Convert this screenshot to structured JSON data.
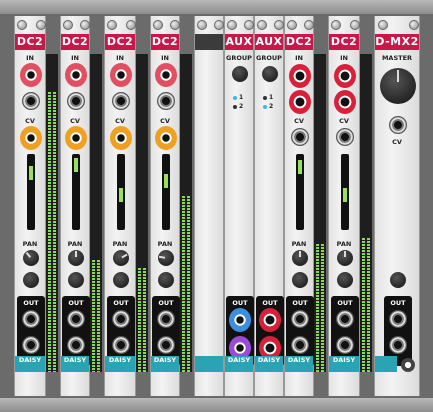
{
  "modules": [
    {
      "id": "dc2-1",
      "title": "DC2",
      "in_label": "IN",
      "cv_label": "CV",
      "pan_label": "PAN",
      "out_label": "OUT",
      "daisy_label": "DAISY",
      "level": 0.4,
      "meter_level": 0.88
    },
    {
      "id": "dc2-2",
      "title": "DC2",
      "in_label": "IN",
      "cv_label": "CV",
      "pan_label": "PAN",
      "out_label": "OUT",
      "daisy_label": "DAISY",
      "level": 0.25,
      "meter_level": 0.35
    },
    {
      "id": "dc2-3",
      "title": "DC2",
      "in_label": "IN",
      "cv_label": "CV",
      "pan_label": "PAN",
      "out_label": "OUT",
      "daisy_label": "DAISY",
      "level": 0.55,
      "meter_level": 0.33
    },
    {
      "id": "dc2-4",
      "title": "DC2",
      "in_label": "IN",
      "cv_label": "CV",
      "pan_label": "PAN",
      "out_label": "OUT",
      "daisy_label": "DAISY",
      "level": 0.45,
      "meter_level": 0.55
    },
    {
      "id": "aux-1",
      "title": "AUX",
      "group_label": "GROUP",
      "sel1": "1",
      "sel2": "2",
      "out_label": "OUT",
      "daisy_label": "DAISY"
    },
    {
      "id": "aux-2",
      "title": "AUX",
      "group_label": "GROUP",
      "sel1": "1",
      "sel2": "2",
      "out_label": "OUT",
      "daisy_label": "DAISY"
    },
    {
      "id": "dc2-5",
      "title": "DC2",
      "in_label": "IN",
      "cv_label": "CV",
      "pan_label": "PAN",
      "out_label": "OUT",
      "daisy_label": "DAISY",
      "level": 0.35,
      "meter_level": 0.4
    },
    {
      "id": "dc2-6",
      "title": "DC2",
      "in_label": "IN",
      "cv_label": "CV",
      "pan_label": "PAN",
      "out_label": "OUT",
      "daisy_label": "DAISY",
      "level": 0.55,
      "meter_level": 0.42
    },
    {
      "id": "dmx2",
      "title": "D-MX2",
      "master_label": "MASTER",
      "cv_label": "CV",
      "out_label": "OUT",
      "daisy_label": "DAISY"
    }
  ],
  "colors": {
    "title": "#c8184a",
    "daisy": "#2aa4b4",
    "meter": "#8cd85a"
  }
}
